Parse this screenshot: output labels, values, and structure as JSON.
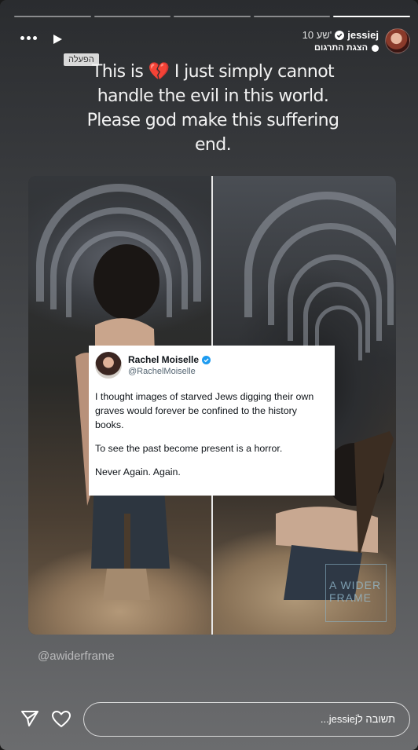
{
  "header": {
    "username": "jessiej",
    "time": "10 שע'",
    "translate_label": "הצגת התרגום",
    "play_tooltip": "הפעלה"
  },
  "caption": {
    "line_before_emoji": "This is ",
    "emoji": "💔",
    "line_after_emoji": " I just simply cannot handle the evil in this world. Please god make this suffering end."
  },
  "tweet": {
    "name": "Rachel Moiselle",
    "handle": "@RachelMoiselle",
    "paragraphs": [
      "I thought images of starved Jews digging their own graves would forever be confined to the history books.",
      "To see the past become present is a horror.",
      "Never Again. Again."
    ]
  },
  "photo": {
    "watermark": "A WIDER FRAME"
  },
  "credit": "@awiderframe",
  "footer": {
    "reply_placeholder": "תשובה לjessiej..."
  },
  "colors": {
    "verified_blue": "#1d9bf0",
    "heart_red": "#d7263d"
  },
  "icons": [
    "more-icon",
    "play-icon",
    "verified-icon",
    "heart-icon",
    "send-icon",
    "translate-icon"
  ],
  "progress": {
    "segments": 5,
    "active_index": 4
  }
}
